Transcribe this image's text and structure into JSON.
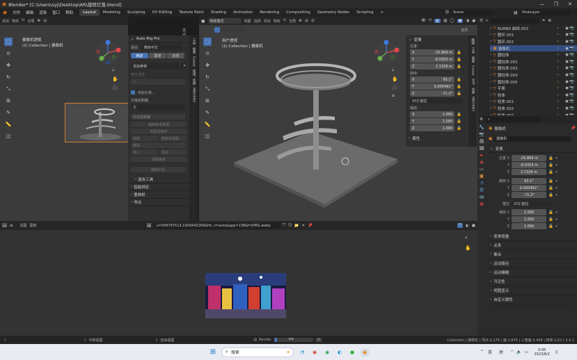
{
  "window": {
    "title": "Blender* [C:\\Users\\syj\\Desktop\\AR\\旋转灯笼.blend]",
    "controls": [
      "—",
      "❐",
      "✕"
    ]
  },
  "menubar": {
    "items": [
      "文件",
      "编辑",
      "渲染",
      "窗口",
      "帮助"
    ],
    "workspaces": [
      "Layout",
      "Modeling",
      "Sculpting",
      "UV Editing",
      "Texture Paint",
      "Shading",
      "Animation",
      "Rendering",
      "Compositing",
      "Geometry Nodes",
      "Scripting"
    ],
    "add_tab": "+",
    "scene": "Scene",
    "view_layer": "ViewLayer"
  },
  "left_viewport": {
    "header_items": [
      "添加",
      "物体"
    ],
    "mode": "全局",
    "options": "选项",
    "camera_title": "摄像机透视",
    "collection": "(1) Collection | 摄像机"
  },
  "autorig": {
    "title": "Auto-Rig Pro",
    "lang_label": "语言:",
    "lang_value": "简体中文",
    "tabs": [
      "绑定",
      "蒙皮",
      "杂项"
    ],
    "add_skeleton": "添加骨架",
    "selected_label": "物件选择",
    "rows_a": [
      "编辑参考骨骼",
      "匹配至绑定",
      "复制",
      "复制并镜像",
      "删除",
      "导入",
      "导出",
      "匹配绑定"
    ],
    "init_checkbox": "初始化骨...",
    "limit_label": "次级控制器",
    "none_value": "无",
    "shape_label": "形状控制器",
    "edit_shape": "编辑形状",
    "pose_tools": "姿态工具",
    "sections": [
      "智能绑定",
      "重映射",
      "导出"
    ]
  },
  "side_tabs_mid": [
    "工具",
    "视图",
    "Cursor",
    "ARP",
    "创建",
    "MACHIN3"
  ],
  "main_viewport": {
    "mode": "物体模式",
    "menus": [
      "视图",
      "选择",
      "添加",
      "物体"
    ],
    "orientation": "全局",
    "title": "用户透视",
    "collection": "(1) Collection | 摄像机",
    "options": "选项"
  },
  "transform_panel": {
    "title": "变换",
    "location_label": "位置:",
    "location": [
      "-25.869 m",
      "-8.0353 m",
      "2.1326 m"
    ],
    "rotation_label": "旋转:",
    "rotation": [
      "93.1°",
      "0.000491°",
      "-71.2°"
    ],
    "rotation_mode": "XYZ 欧拉",
    "scale_label": "缩放:",
    "scale": [
      "1.000",
      "1.000",
      "1.000"
    ],
    "axes": [
      "X",
      "Y",
      "Z"
    ],
    "properties": "属性",
    "side_tabs": [
      "条目",
      "工具",
      "视图",
      "Cursor",
      "ARP",
      "创建",
      "MACHIN3"
    ]
  },
  "outliner": {
    "items": [
      {
        "name": "NURBS 曲线.003",
        "selected": false
      },
      {
        "name": "圆环.001",
        "selected": false
      },
      {
        "name": "圆环.002",
        "selected": false
      },
      {
        "name": "摄像机",
        "selected": true
      },
      {
        "name": "圆柱体",
        "selected": false
      },
      {
        "name": "圆柱体.001",
        "selected": false
      },
      {
        "name": "圆柱体.002",
        "selected": false
      },
      {
        "name": "圆柱体.003",
        "selected": false
      },
      {
        "name": "圆柱体.005",
        "selected": false
      },
      {
        "name": "平面",
        "selected": false
      },
      {
        "name": "柱体",
        "selected": false
      },
      {
        "name": "柱体.001",
        "selected": false
      },
      {
        "name": "柱体.002",
        "selected": false
      },
      {
        "name": "柱体.003",
        "selected": false
      }
    ]
  },
  "properties_editor": {
    "object_label": "摄像机",
    "object_name": "摄像机",
    "transform_title": "变换",
    "location_labels": [
      "位置 X",
      "Y",
      "Z"
    ],
    "location": [
      "-25.869 m",
      "-8.0353 m",
      "2.1326 m"
    ],
    "rotation_labels": [
      "旋转 X",
      "Y",
      "Z"
    ],
    "rotation": [
      "93.1°",
      "0.000491°",
      "-71.2°"
    ],
    "mode_label": "模式",
    "mode_value": "XYZ 欧拉",
    "scale_labels": [
      "缩放 X",
      "Y",
      "Z"
    ],
    "scale": [
      "1.000",
      "1.000",
      "1.000"
    ],
    "sections": [
      "变换增量",
      "关系",
      "集合",
      "运动路径",
      "运动模糊",
      "可见性",
      "视图显示",
      "自定义属性"
    ]
  },
  "image_editor": {
    "menus": [
      "视图",
      "图像"
    ],
    "filename": "u=936797513,1430443269&fm..t=auto&app=138&f=JPEG.webp"
  },
  "statusbar": {
    "left": "平移视图",
    "middle": "自由视图",
    "render_label": "Render",
    "render_percent": "8%",
    "render_progress": 0.08,
    "stats": "Collection | 摄像机 | 顶点:2,176 | 面:1,876 | 三角面:3,404 | 物体:1/22 | 3.4.1"
  },
  "taskbar": {
    "search": "搜索",
    "tray_lang": "英",
    "tray_ime": "拼",
    "time": "0:05",
    "date": "2023/6/2",
    "chevron": "^"
  }
}
